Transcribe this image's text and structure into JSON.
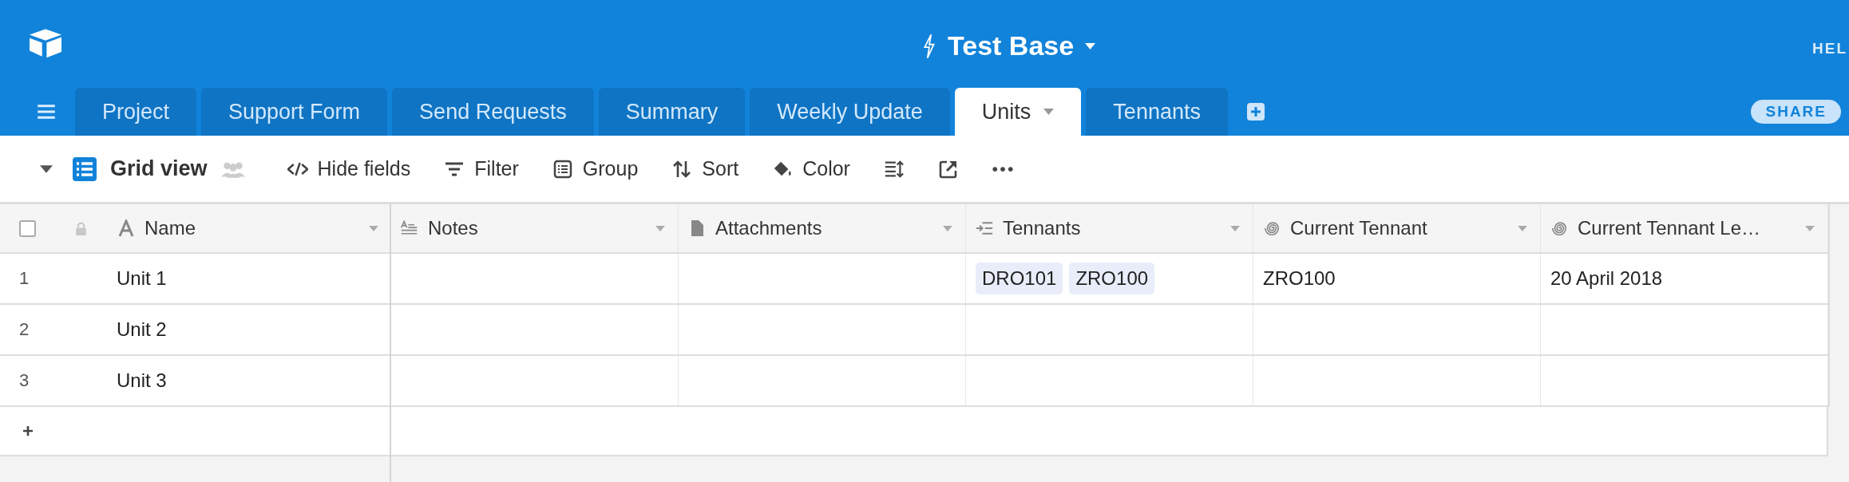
{
  "app_bar": {
    "base_title": "Test Base",
    "help_label": "HEL"
  },
  "tabs": [
    {
      "label": "Project",
      "selected": false
    },
    {
      "label": "Support Form",
      "selected": false
    },
    {
      "label": "Send Requests",
      "selected": false
    },
    {
      "label": "Summary",
      "selected": false
    },
    {
      "label": "Weekly Update",
      "selected": false
    },
    {
      "label": "Units",
      "selected": true
    },
    {
      "label": "Tennants",
      "selected": false
    }
  ],
  "share_label": "SHARE",
  "toolbar": {
    "view_name": "Grid view",
    "actions": [
      {
        "label": "Hide fields",
        "kind": "hide"
      },
      {
        "label": "Filter",
        "kind": "filter"
      },
      {
        "label": "Group",
        "kind": "group"
      },
      {
        "label": "Sort",
        "kind": "sort"
      },
      {
        "label": "Color",
        "kind": "color"
      }
    ]
  },
  "table": {
    "select_all_checked": false,
    "columns": [
      {
        "name": "Name",
        "kind": "text"
      },
      {
        "name": "Notes",
        "kind": "long-text"
      },
      {
        "name": "Attachments",
        "kind": "attachment"
      },
      {
        "name": "Tennants",
        "kind": "link"
      },
      {
        "name": "Current Tennant",
        "kind": "lookup"
      },
      {
        "name": "Current Tennant Le…",
        "kind": "lookup"
      }
    ],
    "rows": [
      {
        "number": "1",
        "cells": [
          "Unit 1",
          null,
          null,
          [
            "DRO101",
            "ZRO100"
          ],
          "ZRO100",
          "20 April 2018"
        ]
      },
      {
        "number": "2",
        "cells": [
          "Unit 2",
          null,
          null,
          null,
          null,
          null
        ]
      },
      {
        "number": "3",
        "cells": [
          "Unit 3",
          null,
          null,
          null,
          null,
          null
        ]
      }
    ]
  }
}
